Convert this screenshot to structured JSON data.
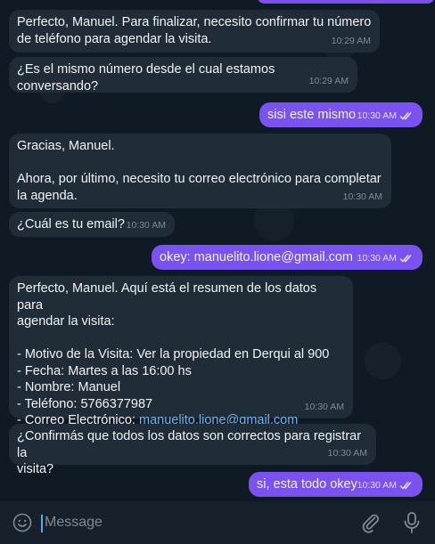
{
  "messages": [
    {
      "dir": "in",
      "lines": [
        "Perfecto, Manuel. Para finalizar, necesito confirmar tu número",
        "de teléfono para agendar la visita."
      ],
      "time": "10:29 AM"
    },
    {
      "dir": "in",
      "lines": [
        "¿Es el mismo número desde el cual estamos conversando?"
      ],
      "time": "10:29 AM"
    },
    {
      "dir": "out",
      "lines": [
        "sisi este mismo"
      ],
      "time": "10:30 AM"
    },
    {
      "dir": "in",
      "lines": [
        "Gracias, Manuel.",
        "",
        "Ahora, por último, necesito tu correo electrónico para completar",
        "la agenda."
      ],
      "time": "10:30 AM"
    },
    {
      "dir": "in",
      "lines": [
        "¿Cuál es tu email?"
      ],
      "time": "10:30 AM"
    },
    {
      "dir": "out",
      "lines": [
        "okey: manuelito.lione@gmail.com"
      ],
      "time": "10:30 AM"
    },
    {
      "dir": "in",
      "lines": [
        "Perfecto, Manuel. Aquí está el resumen de los datos para",
        "agendar la visita:",
        "",
        "- Motivo de la Visita: Ver la propiedad en Derqui al 900",
        "- Fecha: Martes a las 16:00 hs",
        "- Nombre: Manuel",
        "- Teléfono: 5766377987",
        "- Correo Electrónico: "
      ],
      "link": "manuelito.lione@gmail.com",
      "time": "10:30 AM"
    },
    {
      "dir": "in",
      "lines": [
        "¿Confirmás que todos los datos son correctos para registrar la",
        "visita?"
      ],
      "time": "10:30 AM"
    },
    {
      "dir": "out",
      "lines": [
        "si, esta todo okey"
      ],
      "time": "10:30 AM"
    }
  ],
  "composer": {
    "placeholder": "Message",
    "emoji_icon": "smile-emoji-icon",
    "attach_icon": "paperclip-icon",
    "mic_icon": "microphone-icon"
  },
  "colors": {
    "incoming_bubble": "#212c39",
    "outgoing_bubble": "#7a52ef",
    "background": "#0f1a24",
    "link": "#6fb3f0"
  }
}
